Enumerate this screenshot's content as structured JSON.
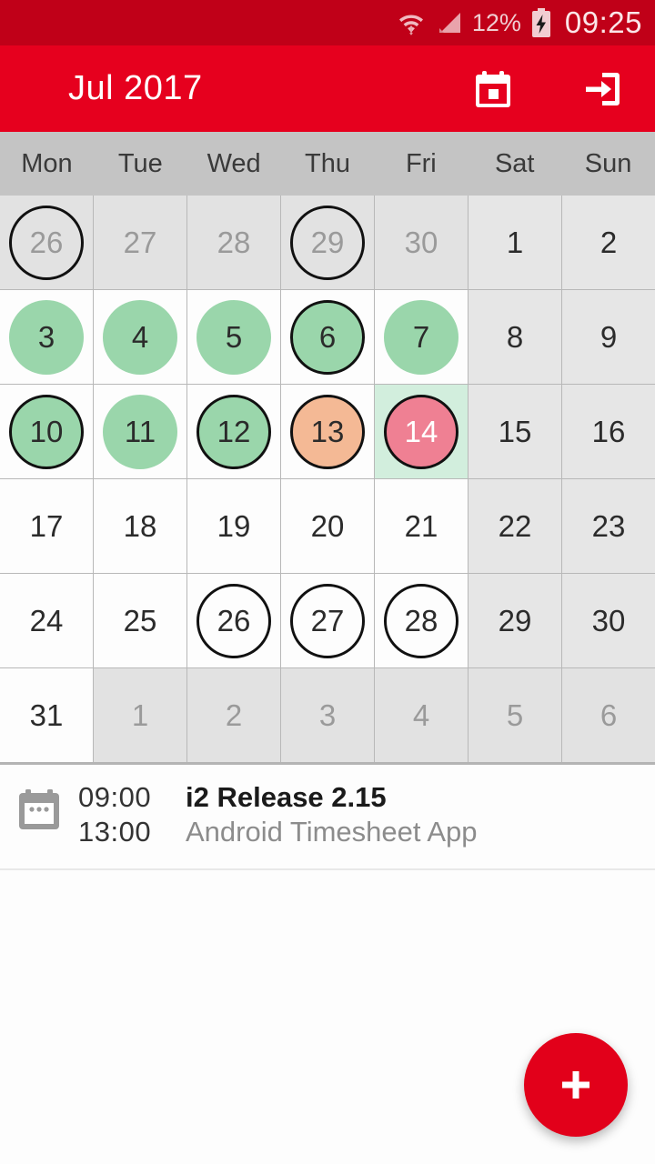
{
  "statusbar": {
    "battery_percent": "12%",
    "time": "09:25",
    "wifi_icon": "wifi-icon",
    "signal_icon": "signal-icon",
    "battery_icon": "battery-charging-icon"
  },
  "toolbar": {
    "title": "Jul 2017",
    "today_label": "today-icon",
    "logout_label": "logout-icon"
  },
  "weekdays": [
    "Mon",
    "Tue",
    "Wed",
    "Thu",
    "Fri",
    "Sat",
    "Sun"
  ],
  "colors": {
    "accent_red": "#e6001e",
    "statusbar_red": "#c00018",
    "green_fill": "#9ad6ab",
    "orange_fill": "#f4b995",
    "pink_fill": "#ef8093",
    "today_cell": "#d2eedd",
    "weekend_cell": "#e6e6e6",
    "other_month_cell": "#e2e2e2",
    "header_gray": "#c4c4c4"
  },
  "calendar": {
    "month": "Jul",
    "year": "2017",
    "weeks": [
      [
        {
          "day": "26",
          "month": "prev",
          "weekend": false,
          "fill": "none",
          "ring": true,
          "today": false
        },
        {
          "day": "27",
          "month": "prev",
          "weekend": false,
          "fill": "none",
          "ring": false,
          "today": false
        },
        {
          "day": "28",
          "month": "prev",
          "weekend": false,
          "fill": "none",
          "ring": false,
          "today": false
        },
        {
          "day": "29",
          "month": "prev",
          "weekend": false,
          "fill": "none",
          "ring": true,
          "today": false
        },
        {
          "day": "30",
          "month": "prev",
          "weekend": false,
          "fill": "none",
          "ring": false,
          "today": false
        },
        {
          "day": "1",
          "month": "current",
          "weekend": true,
          "fill": "none",
          "ring": false,
          "today": false
        },
        {
          "day": "2",
          "month": "current",
          "weekend": true,
          "fill": "none",
          "ring": false,
          "today": false
        }
      ],
      [
        {
          "day": "3",
          "month": "current",
          "weekend": false,
          "fill": "green",
          "ring": false,
          "today": false
        },
        {
          "day": "4",
          "month": "current",
          "weekend": false,
          "fill": "green",
          "ring": false,
          "today": false
        },
        {
          "day": "5",
          "month": "current",
          "weekend": false,
          "fill": "green",
          "ring": false,
          "today": false
        },
        {
          "day": "6",
          "month": "current",
          "weekend": false,
          "fill": "green",
          "ring": true,
          "today": false
        },
        {
          "day": "7",
          "month": "current",
          "weekend": false,
          "fill": "green",
          "ring": false,
          "today": false
        },
        {
          "day": "8",
          "month": "current",
          "weekend": true,
          "fill": "none",
          "ring": false,
          "today": false
        },
        {
          "day": "9",
          "month": "current",
          "weekend": true,
          "fill": "none",
          "ring": false,
          "today": false
        }
      ],
      [
        {
          "day": "10",
          "month": "current",
          "weekend": false,
          "fill": "green",
          "ring": true,
          "today": false
        },
        {
          "day": "11",
          "month": "current",
          "weekend": false,
          "fill": "green",
          "ring": false,
          "today": false
        },
        {
          "day": "12",
          "month": "current",
          "weekend": false,
          "fill": "green",
          "ring": true,
          "today": false
        },
        {
          "day": "13",
          "month": "current",
          "weekend": false,
          "fill": "orange",
          "ring": true,
          "today": false
        },
        {
          "day": "14",
          "month": "current",
          "weekend": false,
          "fill": "pink",
          "ring": true,
          "today": true
        },
        {
          "day": "15",
          "month": "current",
          "weekend": true,
          "fill": "none",
          "ring": false,
          "today": false
        },
        {
          "day": "16",
          "month": "current",
          "weekend": true,
          "fill": "none",
          "ring": false,
          "today": false
        }
      ],
      [
        {
          "day": "17",
          "month": "current",
          "weekend": false,
          "fill": "none",
          "ring": false,
          "today": false
        },
        {
          "day": "18",
          "month": "current",
          "weekend": false,
          "fill": "none",
          "ring": false,
          "today": false
        },
        {
          "day": "19",
          "month": "current",
          "weekend": false,
          "fill": "none",
          "ring": false,
          "today": false
        },
        {
          "day": "20",
          "month": "current",
          "weekend": false,
          "fill": "none",
          "ring": false,
          "today": false
        },
        {
          "day": "21",
          "month": "current",
          "weekend": false,
          "fill": "none",
          "ring": false,
          "today": false
        },
        {
          "day": "22",
          "month": "current",
          "weekend": true,
          "fill": "none",
          "ring": false,
          "today": false
        },
        {
          "day": "23",
          "month": "current",
          "weekend": true,
          "fill": "none",
          "ring": false,
          "today": false
        }
      ],
      [
        {
          "day": "24",
          "month": "current",
          "weekend": false,
          "fill": "none",
          "ring": false,
          "today": false
        },
        {
          "day": "25",
          "month": "current",
          "weekend": false,
          "fill": "none",
          "ring": false,
          "today": false
        },
        {
          "day": "26",
          "month": "current",
          "weekend": false,
          "fill": "none",
          "ring": true,
          "today": false
        },
        {
          "day": "27",
          "month": "current",
          "weekend": false,
          "fill": "none",
          "ring": true,
          "today": false
        },
        {
          "day": "28",
          "month": "current",
          "weekend": false,
          "fill": "none",
          "ring": true,
          "today": false
        },
        {
          "day": "29",
          "month": "current",
          "weekend": true,
          "fill": "none",
          "ring": false,
          "today": false
        },
        {
          "day": "30",
          "month": "current",
          "weekend": true,
          "fill": "none",
          "ring": false,
          "today": false
        }
      ],
      [
        {
          "day": "31",
          "month": "current",
          "weekend": false,
          "fill": "none",
          "ring": false,
          "today": false
        },
        {
          "day": "1",
          "month": "next",
          "weekend": false,
          "fill": "none",
          "ring": false,
          "today": false
        },
        {
          "day": "2",
          "month": "next",
          "weekend": false,
          "fill": "none",
          "ring": false,
          "today": false
        },
        {
          "day": "3",
          "month": "next",
          "weekend": false,
          "fill": "none",
          "ring": false,
          "today": false
        },
        {
          "day": "4",
          "month": "next",
          "weekend": false,
          "fill": "none",
          "ring": false,
          "today": false
        },
        {
          "day": "5",
          "month": "next",
          "weekend": true,
          "fill": "none",
          "ring": false,
          "today": false
        },
        {
          "day": "6",
          "month": "next",
          "weekend": true,
          "fill": "none",
          "ring": false,
          "today": false
        }
      ]
    ]
  },
  "events": [
    {
      "icon": "calendar-event-icon",
      "start_time": "09:00",
      "title": "i2 Release 2.15",
      "end_time": "13:00",
      "subtitle": "Android Timesheet App"
    }
  ],
  "fab": {
    "label": "+",
    "name": "add-event-fab"
  }
}
